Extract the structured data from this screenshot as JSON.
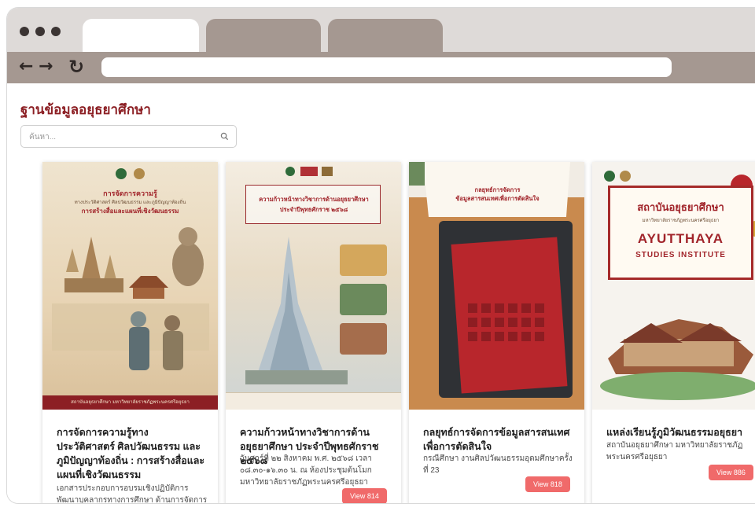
{
  "browser": {
    "icons": {
      "back": "←",
      "forward": "→",
      "reload": "↻"
    }
  },
  "page": {
    "title": "ฐานข้อมูลอยุธยาศึกษา",
    "search_placeholder": "ค้นหา..."
  },
  "colors": {
    "title": "#8c1f24",
    "view_button": "#f06a6a"
  },
  "cards": [
    {
      "title": "การจัดการความรู้ทางประวัติศาสตร์ ศิลปวัฒนธรรม และภูมิปัญญาท้องถิ่น : การสร้างสื่อและแผนที่เชิงวัฒนธรรม",
      "description": "เอกสารประกอบการอบรมเชิงปฏิบัติการพัฒนาบุคลากรทางการศึกษา ด้านการจัดการ",
      "poster_lines": [
        "การจัดการความรู้",
        "ทางประวัติศาสตร์ ศิลปวัฒนธรรม และภูมิปัญญาท้องถิ่น",
        "การสร้างสื่อและแผนที่เชิงวัฒนธรรม"
      ],
      "poster_footer": "สถาบันอยุธยาศึกษา มหาวิทยาลัยราชภัฏพระนครศรีอยุธยา"
    },
    {
      "title": "ความก้าวหน้าทางวิชาการด้านอยุธยาศึกษา ประจำปีพุทธศักราช ๒๕๖๘",
      "description": "วันศุกร์ที่ ๒๒ สิงหาคม พ.ศ. ๒๕๖๘ เวลา ๐๘.๓๐-๑๖.๓๐ น. ณ ห้องประชุมต้นโมก มหาวิทยาลัยราชภัฏพระนครศรีอยุธยา",
      "view": "View 814",
      "poster_lines": [
        "ความก้าวหน้าทางวิชาการด้านอยุธยาศึกษา",
        "ประจำปีพุทธศักราช ๒๕๖๘"
      ]
    },
    {
      "title": "กลยุทธ์การจัดการข้อมูลสารสนเทศเพื่อการตัดสินใจ",
      "description": "กรณีศึกษา งานศิลปวัฒนธรรมอุดมศึกษาครั้งที่ 23",
      "view": "View 818",
      "poster_lines": [
        "กลยุทธ์การจัดการ",
        "ข้อมูลสารสนเทศเพื่อการตัดสินใจ"
      ]
    },
    {
      "title": "แหล่งเรียนรู้ภูมิวัฒนธรรมอยุธยา",
      "description": "สถาบันอยุธยาศึกษา มหาวิทยาลัยราชภัฏพระนครศรีอยุธยา",
      "view": "View 886",
      "poster_lines": [
        "สถาบันอยุธยาศึกษา",
        "มหาวิทยาลัยราชภัฏพระนครศรีอยุธยา",
        "AYUTTHAYA",
        "STUDIES INSTITUTE"
      ]
    }
  ]
}
